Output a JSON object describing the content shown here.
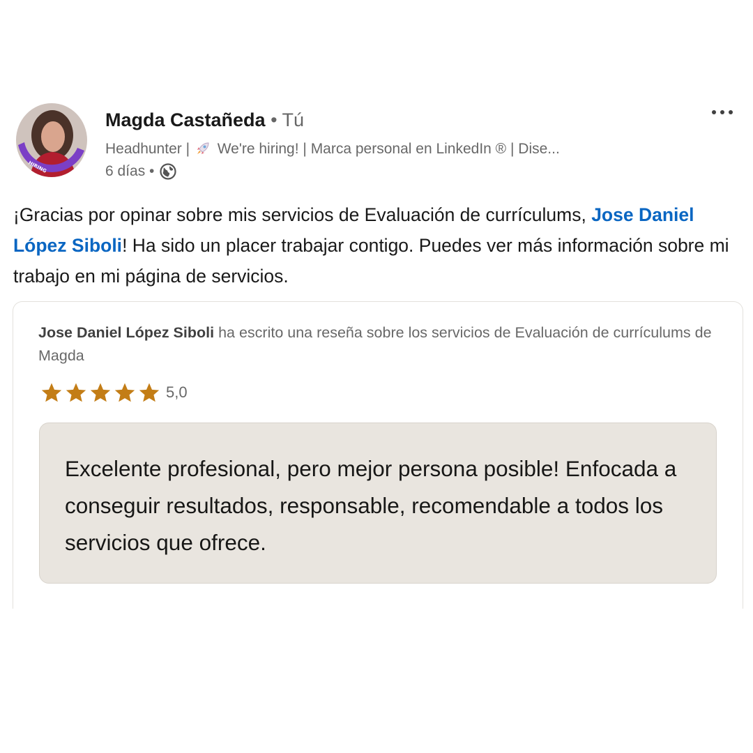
{
  "author": {
    "name": "Magda Castañeda",
    "connection": "• Tú",
    "headline_before": "Headhunter |",
    "headline_after": "We're hiring! | Marca personal en LinkedIn ® | Dise...",
    "time": "6 días •",
    "avatar_badge": "HIRING"
  },
  "post": {
    "text_before": "¡Gracias por opinar sobre mis servicios de Evaluación de currículums, ",
    "mention": "Jose Daniel López Siboli",
    "text_after": "! Ha sido un placer trabajar contigo. Puedes ver más información sobre mi trabajo en mi página de servicios."
  },
  "review": {
    "reviewer": "Jose Daniel López Siboli",
    "summary": " ha escrito una reseña sobre los servicios de Evaluación de currículums de Magda",
    "stars": 5,
    "rating_text": "5,0",
    "quote": "Excelente profesional, pero mejor persona posible! Enfocada a conseguir resultados, responsable, recomendable a todos los servicios que ofrece."
  },
  "colors": {
    "link": "#0a66c2",
    "star": "#c37d16",
    "quote_bg": "#e9e5df",
    "hiring_ring": "#7b3fc6"
  },
  "icons": {
    "more": "more-horizontal-icon",
    "globe": "globe-icon",
    "rocket": "rocket-icon",
    "star": "star-icon"
  }
}
